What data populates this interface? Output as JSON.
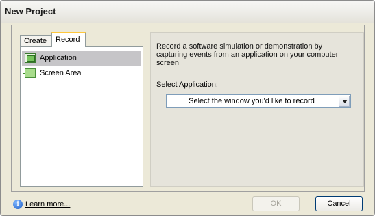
{
  "window": {
    "title": "New Project"
  },
  "tabs": {
    "create_label": "Create",
    "record_label": "Record"
  },
  "list": {
    "items": [
      {
        "label": "Application",
        "icon": "application-icon",
        "selected": true
      },
      {
        "label": "Screen Area",
        "icon": "screen-area-icon",
        "selected": false
      }
    ]
  },
  "details": {
    "description": "Record a software simulation or demonstration by capturing events from an application on your computer screen",
    "select_label": "Select Application:",
    "select_value": "Select the window you'd like to record"
  },
  "footer": {
    "info_icon_glyph": "i",
    "learn_more": "Learn more...",
    "ok_label": "OK",
    "cancel_label": "Cancel"
  }
}
